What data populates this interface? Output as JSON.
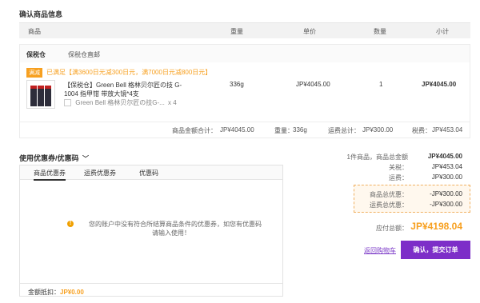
{
  "section_title": "确认商品信息",
  "table_header": {
    "product": "商品",
    "weight": "重量",
    "price": "单价",
    "quantity": "数量",
    "subtotal": "小计"
  },
  "store": {
    "name": "保税仓",
    "shipping": "保税仓直邮"
  },
  "promo": {
    "tag": "满减",
    "text": "已满足【满3600日元减300日元，满7000日元减800日元】"
  },
  "item": {
    "title_line1": "【保税仓】Green Bell 格林贝尔匠の技 G-",
    "title_line2": "1004 指甲钳 带放大镜*4支",
    "sub_title": "Green Bell 格林贝尔匠の技G-...",
    "sub_qty": "x 4",
    "weight": "336g",
    "price": "JP¥4045.00",
    "quantity": "1",
    "subtotal": "JP¥4045.00"
  },
  "subtotal_row": {
    "amount_label": "商品金额合计：",
    "amount": "JP¥4045.00",
    "weight_label": "重量：",
    "weight": "336g",
    "shipping_label": "运费总计：",
    "shipping": "JP¥300.00",
    "tax_label": "税费：",
    "tax": "JP¥453.04"
  },
  "coupon": {
    "header": "使用优惠券/优惠码",
    "tabs": [
      "商品优惠券",
      "运费优惠券",
      "优惠码"
    ],
    "notice_line1": "您的账户中没有符合所结算商品条件的优惠券，如您有优惠码",
    "notice_line2": "请输入使用！",
    "deduct_label": "金额抵扣：",
    "deduct_amount": "JP¥0.00"
  },
  "summary": {
    "items_label": "1件商品，商品总金额",
    "items_value": "JP¥4045.00",
    "tax_label": "关税：",
    "tax_value": "JP¥453.04",
    "shipping_label": "运费：",
    "shipping_value": "JP¥300.00",
    "product_discount_label": "商品总优惠：",
    "product_discount_value": "-JP¥300.00",
    "shipping_discount_label": "运费总优惠：",
    "shipping_discount_value": "-JP¥300.00",
    "total_label": "应付总额：",
    "total_value": "JP¥4198.04"
  },
  "actions": {
    "return_cart": "返回购物车",
    "confirm": "确认，提交订单"
  },
  "colors": {
    "accent": "#f7a020",
    "button": "#7d2ec8"
  }
}
